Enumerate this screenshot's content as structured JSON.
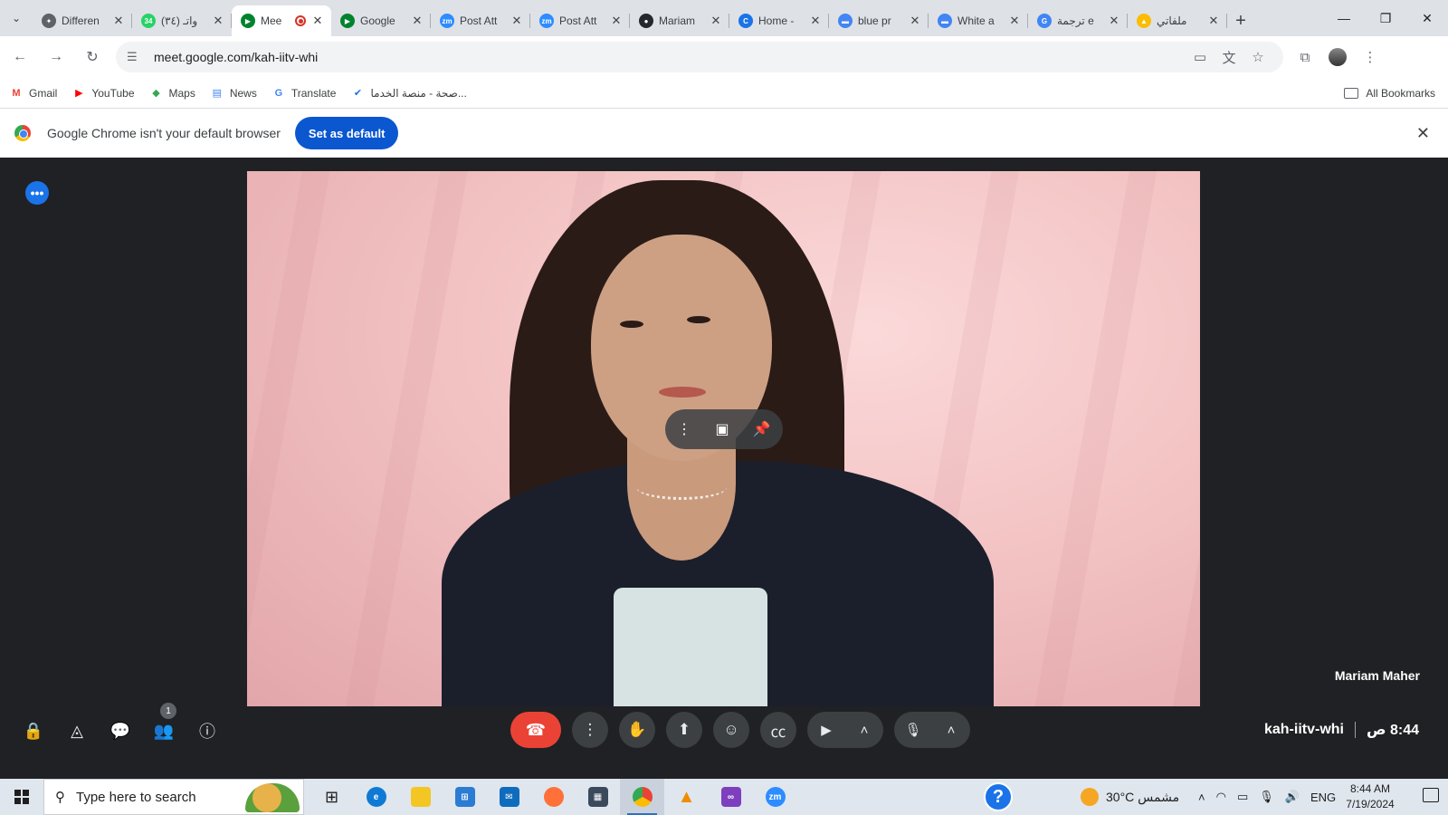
{
  "tabs": [
    {
      "title": "Differen",
      "favicon_color": "#5f6368",
      "favicon_text": "✦"
    },
    {
      "title": "(٣٤) واتـ",
      "favicon_color": "#25d366",
      "favicon_text": "34"
    },
    {
      "title": "Mee",
      "favicon_color": "#00832d",
      "favicon_text": "▶",
      "active": true,
      "recording": true
    },
    {
      "title": "Google",
      "favicon_color": "#00832d",
      "favicon_text": "▶"
    },
    {
      "title": "Post Att",
      "favicon_color": "#2d8cff",
      "favicon_text": "zm"
    },
    {
      "title": "Post Att",
      "favicon_color": "#2d8cff",
      "favicon_text": "zm"
    },
    {
      "title": "Mariam",
      "favicon_color": "#24292f",
      "favicon_text": "●"
    },
    {
      "title": "Home -",
      "favicon_color": "#1a73e8",
      "favicon_text": "C"
    },
    {
      "title": "blue pr",
      "favicon_color": "#4285f4",
      "favicon_text": "▬"
    },
    {
      "title": "White a",
      "favicon_color": "#4285f4",
      "favicon_text": "▬"
    },
    {
      "title": "ترجمة e",
      "favicon_color": "#4285f4",
      "favicon_text": "G"
    },
    {
      "title": "ملفاتي",
      "favicon_color": "#fbbc04",
      "favicon_text": "▲"
    }
  ],
  "toolbar": {
    "url": "meet.google.com/kah-iitv-whi"
  },
  "bookmarks": [
    {
      "label": "Gmail",
      "icon": "M",
      "color": "#ea4335"
    },
    {
      "label": "YouTube",
      "icon": "▶",
      "color": "#ff0000"
    },
    {
      "label": "Maps",
      "icon": "◆",
      "color": "#34a853"
    },
    {
      "label": "News",
      "icon": "▤",
      "color": "#4285f4"
    },
    {
      "label": "Translate",
      "icon": "G",
      "color": "#4285f4"
    },
    {
      "label": "صحة - منصة الخدما...",
      "icon": "✔",
      "color": "#1a73e8"
    }
  ],
  "bookmarks_all": "All Bookmarks",
  "infobar": {
    "message": "Google Chrome isn't your default browser",
    "button": "Set as default"
  },
  "meet": {
    "participant_name": "Mariam Maher",
    "meeting_code": "kah-iitv-whi",
    "time": "8:44 ص",
    "participants_badge": "1"
  },
  "taskbar": {
    "search_placeholder": "Type here to search",
    "weather": "30°C  مشمس",
    "lang": "ENG",
    "clock_time": "8:44 AM",
    "clock_date": "7/19/2024"
  }
}
